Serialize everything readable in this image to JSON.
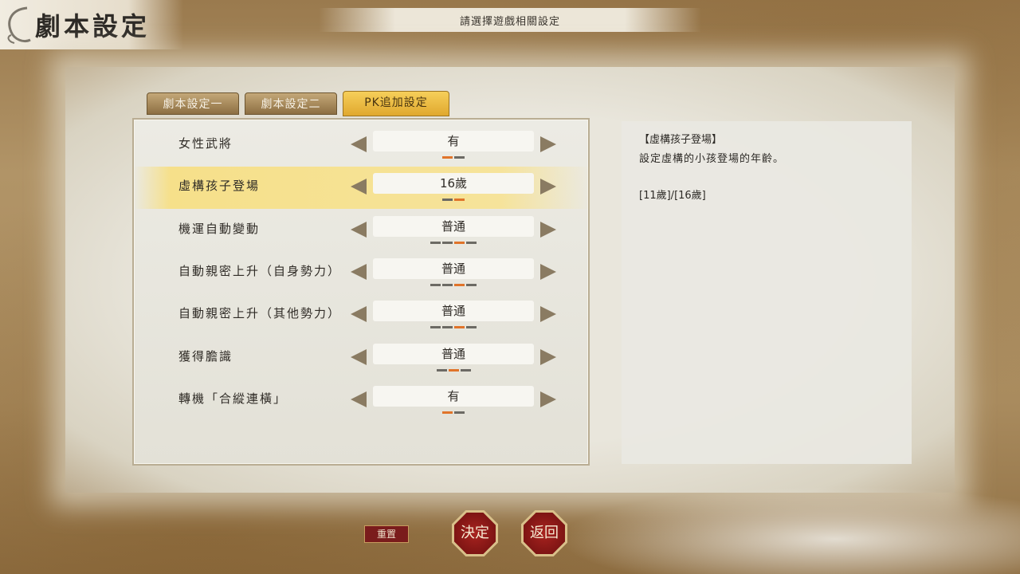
{
  "header": {
    "title": "劇本設定",
    "subtitle": "請選擇遊戲相關設定"
  },
  "tabs": [
    {
      "label": "劇本設定一",
      "active": false
    },
    {
      "label": "劇本設定二",
      "active": false
    },
    {
      "label": "PK追加設定",
      "active": true
    }
  ],
  "settings": [
    {
      "label": "女性武將",
      "value": "有",
      "pips": 2,
      "selected_pip": 1,
      "highlighted": false
    },
    {
      "label": "虛構孩子登場",
      "value": "16歲",
      "pips": 2,
      "selected_pip": 2,
      "highlighted": true
    },
    {
      "label": "機運自動變動",
      "value": "普通",
      "pips": 4,
      "selected_pip": 3,
      "highlighted": false
    },
    {
      "label": "自動親密上升（自身勢力）",
      "value": "普通",
      "pips": 4,
      "selected_pip": 3,
      "highlighted": false
    },
    {
      "label": "自動親密上升（其他勢力）",
      "value": "普通",
      "pips": 4,
      "selected_pip": 3,
      "highlighted": false
    },
    {
      "label": "獲得膽識",
      "value": "普通",
      "pips": 3,
      "selected_pip": 2,
      "highlighted": false
    },
    {
      "label": "轉機「合縱連橫」",
      "value": "有",
      "pips": 2,
      "selected_pip": 1,
      "highlighted": false
    }
  ],
  "description": {
    "title": "【虛構孩子登場】",
    "text": "設定虛構的小孩登場的年齡。",
    "options": "[11歲]/[16歲]"
  },
  "buttons": {
    "reset": "重置",
    "confirm": "決定",
    "back": "返回"
  },
  "colors": {
    "accent_tab": "#f6cf5a",
    "pip_selected": "#e0742a",
    "button_red": "#a8231f"
  }
}
